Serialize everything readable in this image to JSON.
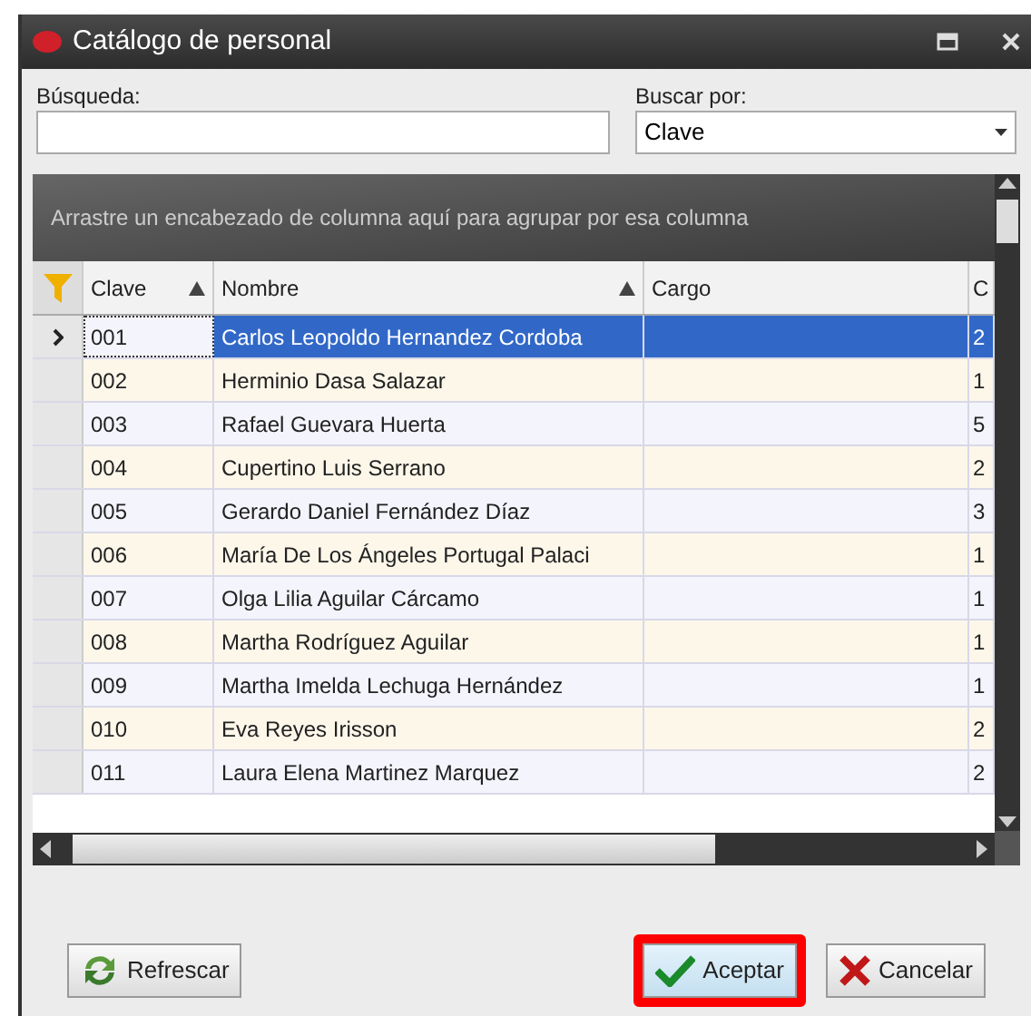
{
  "window": {
    "title": "Catálogo de personal"
  },
  "search": {
    "label": "Búsqueda:"
  },
  "search_by": {
    "label": "Buscar por:",
    "value": "Clave"
  },
  "group_panel": {
    "hint": "Arrastre un encabezado de columna aquí para agrupar por esa columna"
  },
  "columns": [
    {
      "label": "Clave",
      "sorted": true
    },
    {
      "label": "Nombre",
      "sorted": true
    },
    {
      "label": "Cargo",
      "sorted": false
    },
    {
      "label": "C",
      "sorted": false
    }
  ],
  "rows": [
    {
      "cells": [
        "001",
        "Carlos Leopoldo Hernandez Cordoba",
        "",
        "2"
      ],
      "selected": true
    },
    {
      "cells": [
        "002",
        "Herminio Dasa Salazar",
        "",
        "1"
      ],
      "selected": false
    },
    {
      "cells": [
        "003",
        "Rafael Guevara Huerta",
        "",
        "5"
      ],
      "selected": false
    },
    {
      "cells": [
        "004",
        "Cupertino Luis Serrano",
        "",
        "2"
      ],
      "selected": false
    },
    {
      "cells": [
        "005",
        "Gerardo Daniel Fernández Díaz",
        "",
        "3"
      ],
      "selected": false
    },
    {
      "cells": [
        "006",
        "María De Los Ángeles Portugal Palaci",
        "",
        "1"
      ],
      "selected": false
    },
    {
      "cells": [
        "007",
        "Olga Lilia Aguilar Cárcamo",
        "",
        "1"
      ],
      "selected": false
    },
    {
      "cells": [
        "008",
        "Martha Rodríguez Aguilar",
        "",
        "1"
      ],
      "selected": false
    },
    {
      "cells": [
        "009",
        "Martha Imelda Lechuga Hernández",
        "",
        "1"
      ],
      "selected": false
    },
    {
      "cells": [
        "010",
        "Eva Reyes Irisson",
        "",
        "2"
      ],
      "selected": false
    },
    {
      "cells": [
        "011",
        "Laura Elena Martinez Marquez",
        "",
        "2"
      ],
      "selected": false
    }
  ],
  "buttons": [
    {
      "kind": "refresh",
      "label": "Refrescar",
      "highlighted": false
    },
    {
      "kind": "accept",
      "label": "Aceptar",
      "highlighted": true
    },
    {
      "kind": "cancel",
      "label": "Cancelar",
      "highlighted": false
    }
  ]
}
